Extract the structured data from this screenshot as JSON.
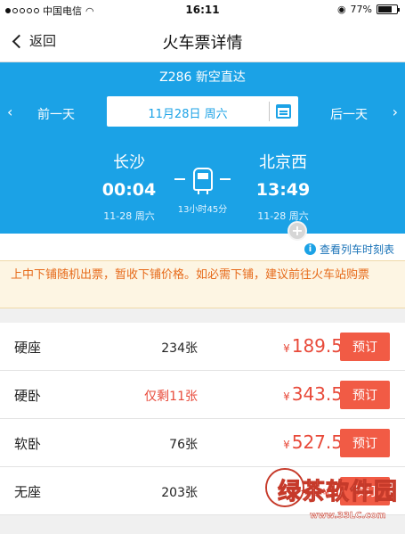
{
  "status_bar": {
    "carrier": "中国电信",
    "time": "16:11",
    "battery": "77%",
    "battery_level": 0.77
  },
  "nav": {
    "back_label": "返回",
    "title": "火车票详情"
  },
  "train": {
    "title": "Z286 新空直达",
    "prev_day": "前一天",
    "next_day": "后一天",
    "date": "11月28日 周六"
  },
  "journey": {
    "from_city": "长沙",
    "from_time": "00:04",
    "from_date": "11-28 周六",
    "to_city": "北京西",
    "to_time": "13:49",
    "to_date": "11-28 周六",
    "duration": "13小时45分"
  },
  "schedule_link": "查看列车时刻表",
  "notice": "上中下铺随机出票，暂收下铺价格。如必需下铺，建议前往火车站购票",
  "tickets": [
    {
      "seat": "硬座",
      "count": "234张",
      "price": "189.5",
      "book": "预订",
      "low": false
    },
    {
      "seat": "硬卧",
      "count": "仅剩11张",
      "price": "343.5",
      "book": "预订",
      "low": true
    },
    {
      "seat": "软卧",
      "count": "76张",
      "price": "527.5",
      "book": "预订",
      "low": false
    },
    {
      "seat": "无座",
      "count": "203张",
      "price": "1",
      "book": "预订",
      "low": false
    }
  ],
  "currency": "¥",
  "watermark": {
    "logo": "绿茶软件园",
    "url": "www.33LC.com"
  },
  "colors": {
    "header_blue": "#1ba2e6",
    "price_red": "#e84a3a",
    "book_button": "#f15b45",
    "notice_orange": "#e66a1a"
  }
}
